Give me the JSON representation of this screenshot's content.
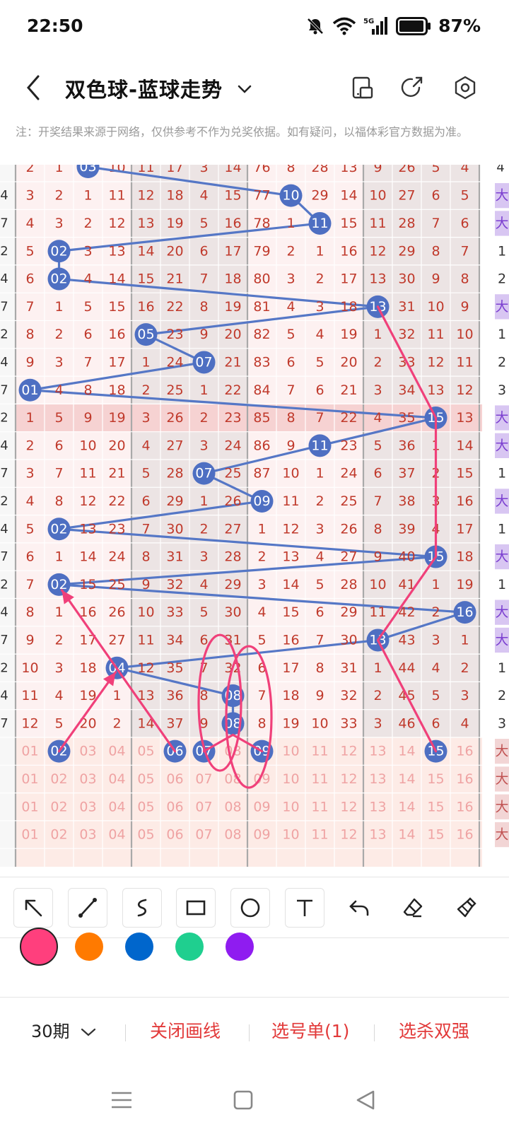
{
  "status": {
    "time": "22:50",
    "battery": "87%",
    "network": "5G"
  },
  "header": {
    "title": "双色球-蓝球走势"
  },
  "note": "注：开奖结果来源于网络，仅供参考不作为兑奖依据。如有疑问，以福体彩官方数据为准。",
  "icons": {
    "back": "back-arrow-icon",
    "dropdown": "chevron-down-icon",
    "layout": "phone-layout-icon",
    "share": "share-icon",
    "settings": "settings-hexagon-icon"
  },
  "chart": {
    "partial_top_row": [
      "2",
      "1",
      "03",
      "10",
      "11",
      "17",
      "3",
      "14",
      "76",
      "8",
      "28",
      "13",
      "9",
      "26",
      "5",
      "4",
      "4"
    ],
    "rows": [
      {
        "l": "4",
        "c": [
          "3",
          "2",
          "1",
          "11",
          "12",
          "18",
          "4",
          "15",
          "77",
          "10",
          "29",
          "14",
          "10",
          "27",
          "6",
          "5"
        ],
        "r": "大",
        "hit": 9
      },
      {
        "l": "7",
        "c": [
          "4",
          "3",
          "2",
          "12",
          "13",
          "19",
          "5",
          "16",
          "78",
          "1",
          "11",
          "15",
          "11",
          "28",
          "7",
          "6"
        ],
        "r": "大",
        "hit": 10
      },
      {
        "l": "2",
        "c": [
          "5",
          "02",
          "3",
          "13",
          "14",
          "20",
          "6",
          "17",
          "79",
          "2",
          "1",
          "16",
          "12",
          "29",
          "8",
          "7"
        ],
        "r": "1",
        "hit": 1
      },
      {
        "l": "4",
        "c": [
          "6",
          "02",
          "4",
          "14",
          "15",
          "21",
          "7",
          "18",
          "80",
          "3",
          "2",
          "17",
          "13",
          "30",
          "9",
          "8"
        ],
        "r": "2",
        "hit": 1
      },
      {
        "l": "7",
        "c": [
          "7",
          "1",
          "5",
          "15",
          "16",
          "22",
          "8",
          "19",
          "81",
          "4",
          "3",
          "18",
          "13",
          "31",
          "10",
          "9"
        ],
        "r": "大",
        "hit": 12
      },
      {
        "l": "2",
        "c": [
          "8",
          "2",
          "6",
          "16",
          "05",
          "23",
          "9",
          "20",
          "82",
          "5",
          "4",
          "19",
          "1",
          "32",
          "11",
          "10"
        ],
        "r": "1",
        "hit": 4
      },
      {
        "l": "4",
        "c": [
          "9",
          "3",
          "7",
          "17",
          "1",
          "24",
          "07",
          "21",
          "83",
          "6",
          "5",
          "20",
          "2",
          "33",
          "12",
          "11"
        ],
        "r": "2",
        "hit": 6
      },
      {
        "l": "7",
        "c": [
          "01",
          "4",
          "8",
          "18",
          "2",
          "25",
          "1",
          "22",
          "84",
          "7",
          "6",
          "21",
          "3",
          "34",
          "13",
          "12"
        ],
        "r": "3",
        "hit": 0
      },
      {
        "l": "2",
        "c": [
          "1",
          "5",
          "9",
          "19",
          "3",
          "26",
          "2",
          "23",
          "85",
          "8",
          "7",
          "22",
          "4",
          "35",
          "15",
          "13"
        ],
        "r": "大",
        "hit": 14
      },
      {
        "l": "4",
        "c": [
          "2",
          "6",
          "10",
          "20",
          "4",
          "27",
          "3",
          "24",
          "86",
          "9",
          "11",
          "23",
          "5",
          "36",
          "1",
          "14"
        ],
        "r": "大",
        "hit": 10
      },
      {
        "l": "7",
        "c": [
          "3",
          "7",
          "11",
          "21",
          "5",
          "28",
          "07",
          "25",
          "87",
          "10",
          "1",
          "24",
          "6",
          "37",
          "2",
          "15"
        ],
        "r": "1",
        "hit": 6
      },
      {
        "l": "2",
        "c": [
          "4",
          "8",
          "12",
          "22",
          "6",
          "29",
          "1",
          "26",
          "09",
          "11",
          "2",
          "25",
          "7",
          "38",
          "3",
          "16"
        ],
        "r": "大",
        "hit": 8
      },
      {
        "l": "4",
        "c": [
          "5",
          "02",
          "13",
          "23",
          "7",
          "30",
          "2",
          "27",
          "1",
          "12",
          "3",
          "26",
          "8",
          "39",
          "4",
          "17"
        ],
        "r": "1",
        "hit": 1
      },
      {
        "l": "7",
        "c": [
          "6",
          "1",
          "14",
          "24",
          "8",
          "31",
          "3",
          "28",
          "2",
          "13",
          "4",
          "27",
          "9",
          "40",
          "15",
          "18"
        ],
        "r": "大",
        "hit": 14
      },
      {
        "l": "2",
        "c": [
          "7",
          "02",
          "15",
          "25",
          "9",
          "32",
          "4",
          "29",
          "3",
          "14",
          "5",
          "28",
          "10",
          "41",
          "1",
          "19"
        ],
        "r": "1",
        "hit": 1
      },
      {
        "l": "4",
        "c": [
          "8",
          "1",
          "16",
          "26",
          "10",
          "33",
          "5",
          "30",
          "4",
          "15",
          "6",
          "29",
          "11",
          "42",
          "2",
          "16"
        ],
        "r": "大",
        "hit": 15
      },
      {
        "l": "7",
        "c": [
          "9",
          "2",
          "17",
          "27",
          "11",
          "34",
          "6",
          "31",
          "5",
          "16",
          "7",
          "30",
          "13",
          "43",
          "3",
          "1"
        ],
        "r": "大",
        "hit": 12
      },
      {
        "l": "2",
        "c": [
          "10",
          "3",
          "18",
          "04",
          "12",
          "35",
          "7",
          "32",
          "6",
          "17",
          "8",
          "31",
          "1",
          "44",
          "4",
          "2"
        ],
        "r": "1",
        "hit": 3
      },
      {
        "l": "4",
        "c": [
          "11",
          "4",
          "19",
          "1",
          "13",
          "36",
          "8",
          "08",
          "7",
          "18",
          "9",
          "32",
          "2",
          "45",
          "5",
          "3"
        ],
        "r": "2",
        "hit": 7
      },
      {
        "l": "7",
        "c": [
          "12",
          "5",
          "20",
          "2",
          "14",
          "37",
          "9",
          "08",
          "8",
          "19",
          "10",
          "33",
          "3",
          "46",
          "6",
          "4"
        ],
        "r": "3",
        "hit": 7
      }
    ],
    "pred_rows": [
      {
        "c": [
          "01",
          "02",
          "03",
          "04",
          "05",
          "06",
          "07",
          "08",
          "09",
          "10",
          "11",
          "12",
          "13",
          "14",
          "15",
          "16"
        ],
        "r": "大",
        "marks": [
          1,
          5,
          6,
          8,
          14
        ]
      },
      {
        "c": [
          "01",
          "02",
          "03",
          "04",
          "05",
          "06",
          "07",
          "08",
          "09",
          "10",
          "11",
          "12",
          "13",
          "14",
          "15",
          "16"
        ],
        "r": "大",
        "marks": []
      },
      {
        "c": [
          "01",
          "02",
          "03",
          "04",
          "05",
          "06",
          "07",
          "08",
          "09",
          "10",
          "11",
          "12",
          "13",
          "14",
          "15",
          "16"
        ],
        "r": "大",
        "marks": []
      },
      {
        "c": [
          "01",
          "02",
          "03",
          "04",
          "05",
          "06",
          "07",
          "08",
          "09",
          "10",
          "11",
          "12",
          "13",
          "14",
          "15",
          "16"
        ],
        "r": "大",
        "marks": []
      }
    ]
  },
  "tools": [
    {
      "name": "arrow-tool",
      "icon": "arrow-icon"
    },
    {
      "name": "line-tool",
      "icon": "line-icon"
    },
    {
      "name": "curve-tool",
      "icon": "curve-icon"
    },
    {
      "name": "rectangle-tool",
      "icon": "rectangle-icon"
    },
    {
      "name": "circle-tool",
      "icon": "circle-icon"
    },
    {
      "name": "text-tool",
      "icon": "text-icon"
    },
    {
      "name": "undo-tool",
      "icon": "undo-icon"
    },
    {
      "name": "eraser-tool",
      "icon": "eraser-icon"
    },
    {
      "name": "clear-tool",
      "icon": "broom-icon"
    }
  ],
  "colors": [
    "#ff3f7d",
    "#ff7a00",
    "#0066cc",
    "#1fcf8f",
    "#8f1cf0"
  ],
  "selected_color": "#ff3f7d",
  "bottom": {
    "period": "30期",
    "close_lines": "关闭画线",
    "selection": "选号单(1)",
    "kill": "选杀双强"
  }
}
